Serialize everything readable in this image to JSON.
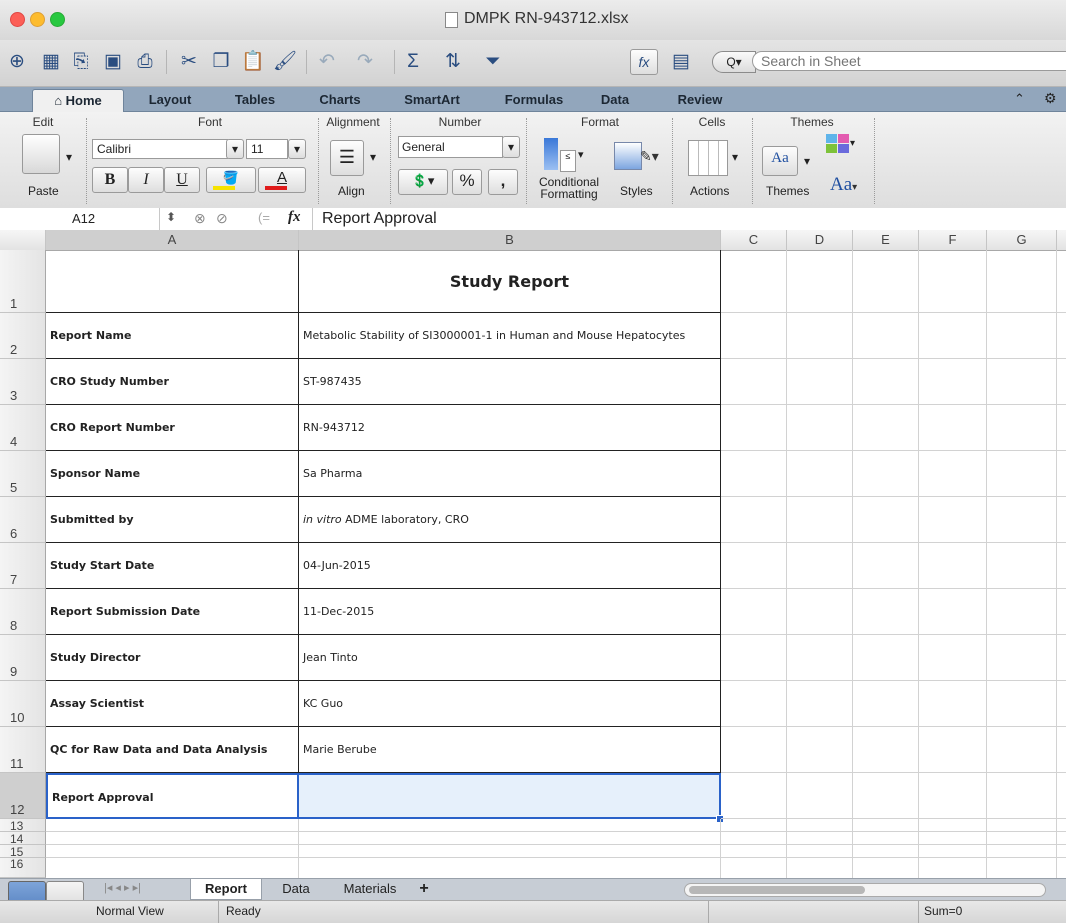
{
  "window": {
    "title": "DMPK RN-943712.xlsx"
  },
  "toolbar": {
    "search_placeholder": "Search in Sheet",
    "search_btn": "Q▾"
  },
  "ribbon_tabs": [
    "Home",
    "Layout",
    "Tables",
    "Charts",
    "SmartArt",
    "Formulas",
    "Data",
    "Review"
  ],
  "ribbon": {
    "groups": {
      "edit": "Edit",
      "font": "Font",
      "alignment": "Alignment",
      "number": "Number",
      "format": "Format",
      "cells": "Cells",
      "themes": "Themes"
    },
    "paste": "Paste",
    "font_name": "Calibri",
    "font_size": "11",
    "bold": "B",
    "italic": "I",
    "underline": "U",
    "align": "Align",
    "number_format": "General",
    "percent": "%",
    "comma": ",",
    "conditional_formatting": "Conditional Formatting",
    "conditional_line1": "Conditional",
    "conditional_line2": "Formatting",
    "styles": "Styles",
    "actions": "Actions",
    "themes_label": "Themes",
    "themes_aa": "Aa",
    "themes_aa2": "Aa"
  },
  "formula_bar": {
    "name_box": "A12",
    "fx": "fx",
    "content": "Report Approval"
  },
  "columns": [
    "A",
    "B",
    "C",
    "D",
    "E",
    "F",
    "G"
  ],
  "sheet": {
    "title": "Study Report",
    "rows": [
      {
        "num": "1",
        "a": "",
        "b": ""
      },
      {
        "num": "2",
        "a": "Report Name",
        "b": "Metabolic Stability of SI3000001-1 in Human and Mouse Hepatocytes"
      },
      {
        "num": "3",
        "a": "CRO Study Number",
        "b": "ST-987435"
      },
      {
        "num": "4",
        "a": "CRO Report Number",
        "b": "RN-943712"
      },
      {
        "num": "5",
        "a": "Sponsor Name",
        "b": "Sa Pharma"
      },
      {
        "num": "6",
        "a": "Submitted by",
        "b_italic": "in vitro",
        "b": " ADME laboratory, CRO"
      },
      {
        "num": "7",
        "a": "Study Start Date",
        "b": "04-Jun-2015"
      },
      {
        "num": "8",
        "a": "Report Submission Date",
        "b": "11-Dec-2015"
      },
      {
        "num": "9",
        "a": "Study Director",
        "b": "Jean Tinto"
      },
      {
        "num": "10",
        "a": "Assay Scientist",
        "b": "KC Guo"
      },
      {
        "num": "11",
        "a": "QC for Raw Data and Data Analysis",
        "b": "Marie Berube"
      },
      {
        "num": "12",
        "a": "Report Approval",
        "b": ""
      }
    ],
    "extra_rows": [
      "13",
      "14",
      "15",
      "16"
    ]
  },
  "sheet_tabs": [
    "Report",
    "Data",
    "Materials",
    "+"
  ],
  "status": {
    "view": "Normal View",
    "state": "Ready",
    "sum": "Sum=0"
  },
  "colors": {
    "selection": "#2a62c9",
    "selection_fill": "#e6f0fb",
    "ribbon_tab_bg": "#92a6bc"
  }
}
